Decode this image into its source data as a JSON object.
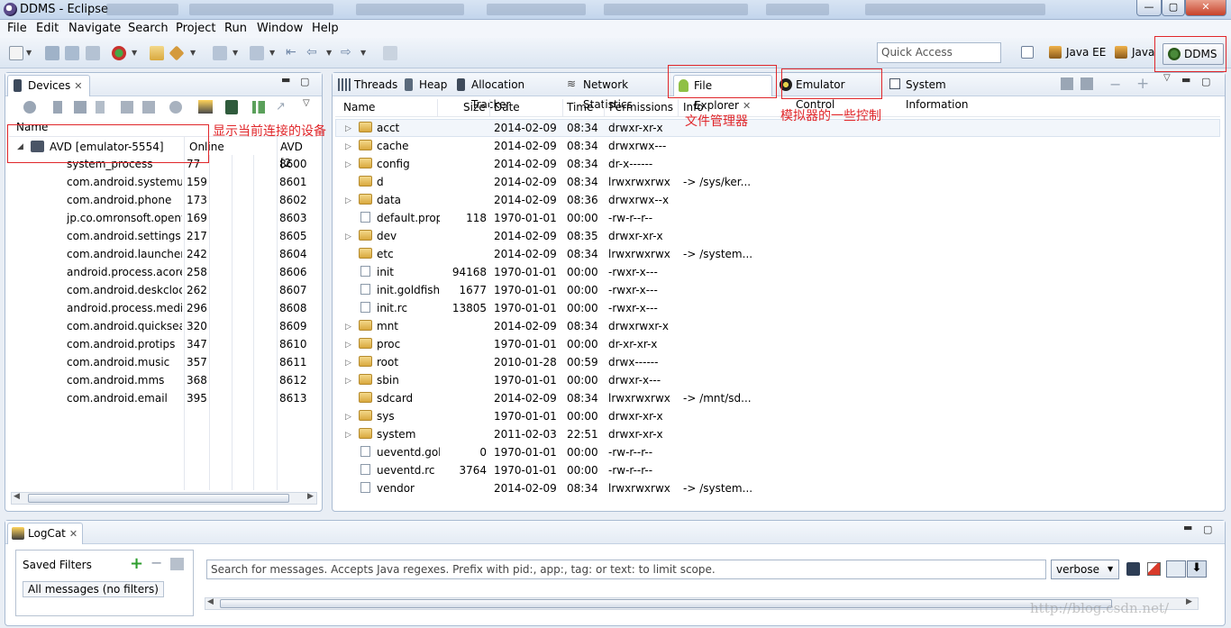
{
  "window": {
    "title": "DDMS - Eclipse",
    "minimize": "—",
    "maximize": "▢",
    "close": "✕"
  },
  "menu": [
    "File",
    "Edit",
    "Navigate",
    "Search",
    "Project",
    "Run",
    "Window",
    "Help"
  ],
  "toolbar": {
    "quick_access_placeholder": "Quick Access",
    "perspectives": {
      "java_ee": "Java EE",
      "java": "Java",
      "ddms": "DDMS"
    }
  },
  "devices": {
    "tab_label": "Devices",
    "columns": {
      "name": "Name",
      "status": "Online",
      "avd": "AVD [2"
    },
    "device": {
      "name": "AVD [emulator-5554]",
      "status": "Online",
      "avd": "AVD [2"
    },
    "processes": [
      {
        "name": "system_process",
        "pid": "77",
        "port": "8600"
      },
      {
        "name": "com.android.systemui",
        "pid": "159",
        "port": "8601"
      },
      {
        "name": "com.android.phone",
        "pid": "173",
        "port": "8602"
      },
      {
        "name": "jp.co.omronsoft.openwnn",
        "pid": "169",
        "port": "8603"
      },
      {
        "name": "com.android.settings",
        "pid": "217",
        "port": "8605"
      },
      {
        "name": "com.android.launcher",
        "pid": "242",
        "port": "8604"
      },
      {
        "name": "android.process.acore",
        "pid": "258",
        "port": "8606"
      },
      {
        "name": "com.android.deskclock",
        "pid": "262",
        "port": "8607"
      },
      {
        "name": "android.process.media",
        "pid": "296",
        "port": "8608"
      },
      {
        "name": "com.android.quicksearchbox",
        "pid": "320",
        "port": "8609"
      },
      {
        "name": "com.android.protips",
        "pid": "347",
        "port": "8610"
      },
      {
        "name": "com.android.music",
        "pid": "357",
        "port": "8611"
      },
      {
        "name": "com.android.mms",
        "pid": "368",
        "port": "8612"
      },
      {
        "name": "com.android.email",
        "pid": "395",
        "port": "8613"
      }
    ]
  },
  "right_tabs": {
    "threads": "Threads",
    "heap": "Heap",
    "allocation": "Allocation Tracker",
    "network": "Network Statistics",
    "file_explorer": "File Explorer",
    "emulator": "Emulator Control",
    "sysinfo": "System Information"
  },
  "file_explorer": {
    "columns": {
      "name": "Name",
      "size": "Size",
      "date": "Date",
      "time": "Time",
      "permissions": "Permissions",
      "info": "Info"
    },
    "rows": [
      {
        "name": "acct",
        "size": "",
        "date": "2014-02-09",
        "time": "08:34",
        "perm": "drwxr-xr-x",
        "info": "",
        "type": "folder",
        "expand": true
      },
      {
        "name": "cache",
        "size": "",
        "date": "2014-02-09",
        "time": "08:34",
        "perm": "drwxrwx---",
        "info": "",
        "type": "folder",
        "expand": true
      },
      {
        "name": "config",
        "size": "",
        "date": "2014-02-09",
        "time": "08:34",
        "perm": "dr-x------",
        "info": "",
        "type": "folder",
        "expand": true
      },
      {
        "name": "d",
        "size": "",
        "date": "2014-02-09",
        "time": "08:34",
        "perm": "lrwxrwxrwx",
        "info": "-> /sys/ker...",
        "type": "folder",
        "expand": false
      },
      {
        "name": "data",
        "size": "",
        "date": "2014-02-09",
        "time": "08:36",
        "perm": "drwxrwx--x",
        "info": "",
        "type": "folder",
        "expand": true
      },
      {
        "name": "default.prop",
        "size": "118",
        "date": "1970-01-01",
        "time": "00:00",
        "perm": "-rw-r--r--",
        "info": "",
        "type": "file",
        "expand": false
      },
      {
        "name": "dev",
        "size": "",
        "date": "2014-02-09",
        "time": "08:35",
        "perm": "drwxr-xr-x",
        "info": "",
        "type": "folder",
        "expand": true
      },
      {
        "name": "etc",
        "size": "",
        "date": "2014-02-09",
        "time": "08:34",
        "perm": "lrwxrwxrwx",
        "info": "-> /system...",
        "type": "folder",
        "expand": false
      },
      {
        "name": "init",
        "size": "94168",
        "date": "1970-01-01",
        "time": "00:00",
        "perm": "-rwxr-x---",
        "info": "",
        "type": "file",
        "expand": false
      },
      {
        "name": "init.goldfish.rc",
        "size": "1677",
        "date": "1970-01-01",
        "time": "00:00",
        "perm": "-rwxr-x---",
        "info": "",
        "type": "file",
        "expand": false
      },
      {
        "name": "init.rc",
        "size": "13805",
        "date": "1970-01-01",
        "time": "00:00",
        "perm": "-rwxr-x---",
        "info": "",
        "type": "file",
        "expand": false
      },
      {
        "name": "mnt",
        "size": "",
        "date": "2014-02-09",
        "time": "08:34",
        "perm": "drwxrwxr-x",
        "info": "",
        "type": "folder",
        "expand": true
      },
      {
        "name": "proc",
        "size": "",
        "date": "1970-01-01",
        "time": "00:00",
        "perm": "dr-xr-xr-x",
        "info": "",
        "type": "folder",
        "expand": true
      },
      {
        "name": "root",
        "size": "",
        "date": "2010-01-28",
        "time": "00:59",
        "perm": "drwx------",
        "info": "",
        "type": "folder",
        "expand": true
      },
      {
        "name": "sbin",
        "size": "",
        "date": "1970-01-01",
        "time": "00:00",
        "perm": "drwxr-x---",
        "info": "",
        "type": "folder",
        "expand": true
      },
      {
        "name": "sdcard",
        "size": "",
        "date": "2014-02-09",
        "time": "08:34",
        "perm": "lrwxrwxrwx",
        "info": "-> /mnt/sd...",
        "type": "folder",
        "expand": false
      },
      {
        "name": "sys",
        "size": "",
        "date": "1970-01-01",
        "time": "00:00",
        "perm": "drwxr-xr-x",
        "info": "",
        "type": "folder",
        "expand": true
      },
      {
        "name": "system",
        "size": "",
        "date": "2011-02-03",
        "time": "22:51",
        "perm": "drwxr-xr-x",
        "info": "",
        "type": "folder",
        "expand": true
      },
      {
        "name": "ueventd.goldfish.rc",
        "size": "0",
        "date": "1970-01-01",
        "time": "00:00",
        "perm": "-rw-r--r--",
        "info": "",
        "type": "file",
        "expand": false
      },
      {
        "name": "ueventd.rc",
        "size": "3764",
        "date": "1970-01-01",
        "time": "00:00",
        "perm": "-rw-r--r--",
        "info": "",
        "type": "file",
        "expand": false
      },
      {
        "name": "vendor",
        "size": "",
        "date": "2014-02-09",
        "time": "08:34",
        "perm": "lrwxrwxrwx",
        "info": "-> /system...",
        "type": "file",
        "expand": false
      }
    ]
  },
  "annotations": {
    "devices_note": "显示当前连接的设备",
    "file_explorer_note": "文件管理器",
    "emulator_note": "模拟器的一些控制"
  },
  "logcat": {
    "tab_label": "LogCat",
    "saved_filters": "Saved Filters",
    "all_messages": "All messages (no filters)",
    "search_placeholder": "Search for messages. Accepts Java regexes. Prefix with pid:, app:, tag: or text: to limit scope.",
    "level": "verbose"
  },
  "watermark": "http://blog.csdn.net/"
}
